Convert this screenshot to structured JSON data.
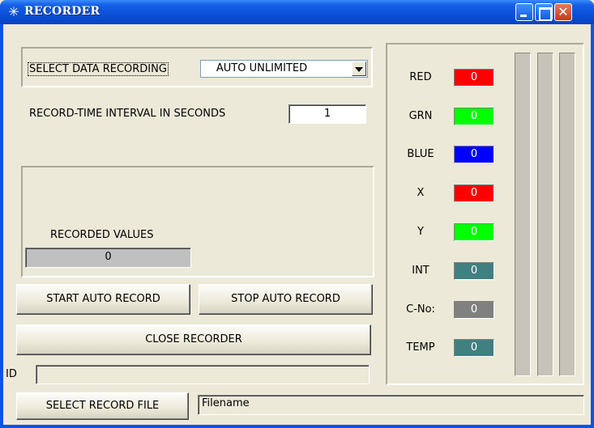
{
  "window": {
    "title": "RECORDER",
    "icon": "asterisk-icon",
    "close_glyph": "✕"
  },
  "recording": {
    "select_label": "SELECT DATA RECORDING",
    "select_value": "AUTO UNLIMITED",
    "interval_label": "RECORD-TIME INTERVAL IN SECONDS",
    "interval_value": "1",
    "recorded_label": "RECORDED VALUES",
    "recorded_value": "0"
  },
  "buttons": {
    "start": "START AUTO RECORD",
    "stop": "STOP AUTO RECORD",
    "close": "CLOSE RECORDER",
    "select_file": "SELECT RECORD FILE"
  },
  "id_field": {
    "label": "ID",
    "value": ""
  },
  "filename": {
    "value": "Filename"
  },
  "sensors": [
    {
      "label": "RED",
      "value": "0",
      "color": "#ff0000"
    },
    {
      "label": "GRN",
      "value": "0",
      "color": "#00ff00"
    },
    {
      "label": "BLUE",
      "value": "0",
      "color": "#0000ff"
    },
    {
      "label": "X",
      "value": "0",
      "color": "#ff0000"
    },
    {
      "label": "Y",
      "value": "0",
      "color": "#00ff00"
    },
    {
      "label": "INT",
      "value": "0",
      "color": "#408080"
    },
    {
      "label": "C-No:",
      "value": "0",
      "color": "#808080"
    },
    {
      "label": "TEMP",
      "value": "0",
      "color": "#408080"
    }
  ],
  "colors": {
    "title_bar": "#0a4fd8",
    "face": "#ece9d8"
  }
}
